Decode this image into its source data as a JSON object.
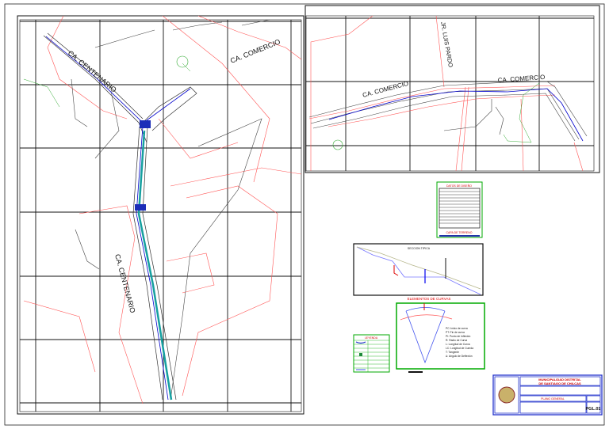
{
  "streets": {
    "centenario_top": "CA. CENTENARIO",
    "centenario_mid": "CA. CENTENARIO",
    "comercio_left": "CA. COMERCIO",
    "comercio_right_1": "CA. COMERCIO",
    "comercio_right_2": "CA. COMERCIO",
    "luis_pardo": "JR. LUIS PARDO"
  },
  "design_table": {
    "title": "DATOS DE DISEÑO",
    "subtitle": "CAPA DE TERRENO"
  },
  "section": {
    "title": "SECCION TIPICA"
  },
  "curves": {
    "title": "ELEMENTOS DE CURVAS",
    "items": [
      "PC: Inicio de curva",
      "PT: Fin de curva",
      "PI: Punto de Inflexión",
      "R: Radio de Curva",
      "L: Longitud de Curva",
      "LC: Longitud de Cuerda",
      "T: Tangente",
      "Δ: Angulo de Deflexión"
    ]
  },
  "legend": {
    "title": "LEYENDA"
  },
  "title_block": {
    "institution_1": "MUNICIPALIDAD DISTRITAL",
    "institution_2": "DE SANTIAGO DE CHILCAS",
    "sheet_title": "PLANO GENERAL",
    "sheet_code": "PGL.01"
  },
  "colors": {
    "road": "#0000cc",
    "boundary": "#ff4444",
    "canal": "#16a0a0",
    "frame": "#00aa00",
    "title": "#cc0000"
  }
}
